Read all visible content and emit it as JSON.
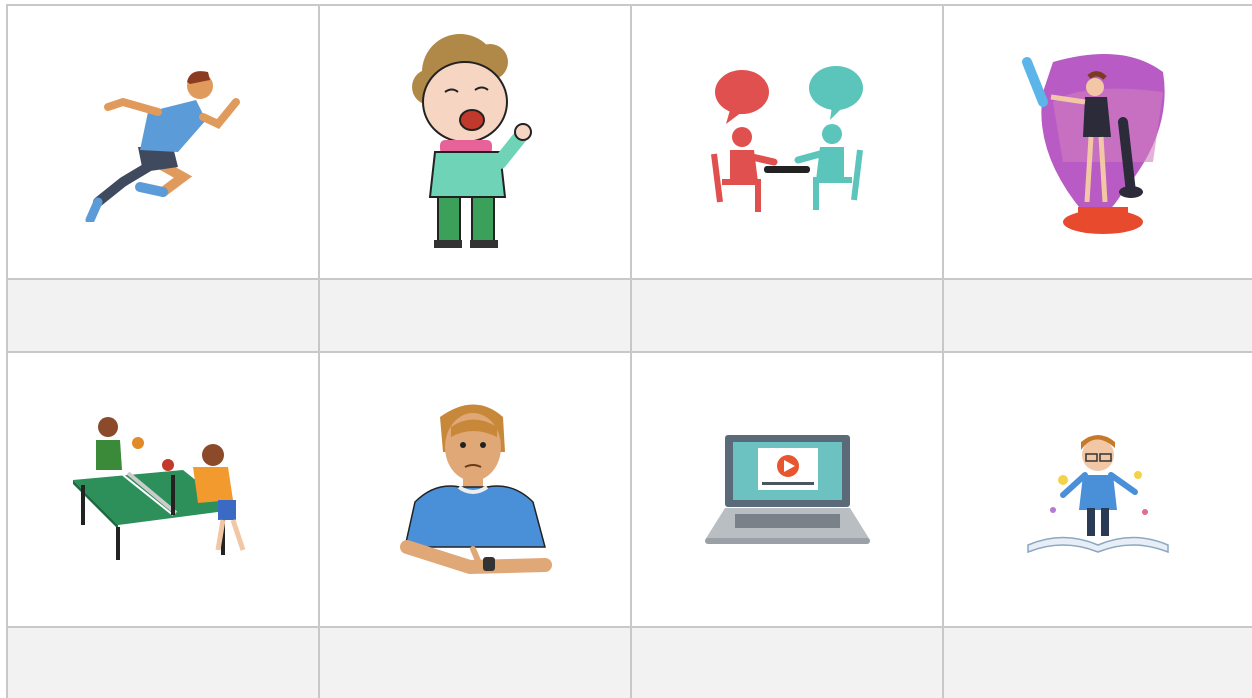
{
  "worksheet": {
    "rows": [
      {
        "images": [
          {
            "icon": "runner-icon"
          },
          {
            "icon": "singing-boy-icon"
          },
          {
            "icon": "conversation-icon"
          },
          {
            "icon": "maid-cleaning-icon"
          }
        ],
        "labels": [
          "",
          "",
          "",
          ""
        ]
      },
      {
        "images": [
          {
            "icon": "table-tennis-icon"
          },
          {
            "icon": "man-checking-watch-icon"
          },
          {
            "icon": "laptop-video-icon"
          },
          {
            "icon": "boy-reading-book-icon"
          }
        ],
        "labels": [
          "",
          "",
          "",
          ""
        ]
      }
    ]
  },
  "colors": {
    "grid_line": "#c8c8c8",
    "label_row_bg": "#f2f2f2",
    "image_row_bg": "#ffffff"
  }
}
